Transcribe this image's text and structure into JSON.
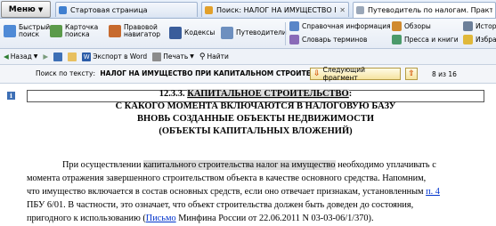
{
  "tabbar": {
    "menu_label": "Меню",
    "tabs": [
      {
        "label": "Стартовая страница",
        "active": false
      },
      {
        "label": "Поиск: НАЛОГ НА ИМУЩЕСТВО ПРИ...",
        "active": false
      },
      {
        "label": "Путеводитель по налогам. Практичес...",
        "active": true
      }
    ]
  },
  "bigbar": {
    "quick_search": [
      "Быстрый",
      "поиск"
    ],
    "search_card": [
      "Карточка",
      "поиска"
    ],
    "legal_nav": [
      "Правовой",
      "навигатор"
    ],
    "codes": "Кодексы",
    "guides": "Путеводители",
    "reference_info": "Справочная информация",
    "terms_dictionary": "Словарь терминов",
    "reviews": "Обзоры",
    "press_books": "Пресса и книги",
    "history": "Истор",
    "favorites": "Избран"
  },
  "navbar": {
    "back": "Назад",
    "export_word": "Экспорт в Word",
    "print": "Печать",
    "find": "Найти"
  },
  "searchbar": {
    "prefix": "Поиск по тексту:",
    "query": "НАЛОГ НА ИМУЩЕСТВО ПРИ КАПИТАЛЬНОМ СТРОИТЕЛЬСТВЕ",
    "next_fragment": "Следующий фрагмент",
    "counter": "8 из 16"
  },
  "document": {
    "info_marker": "i",
    "heading_num": "12.3.3. ",
    "heading_hl": "КАПИТАЛЬНОЕ СТРОИТЕЛЬСТВО",
    "heading_colon": ":",
    "heading_line2": "С КАКОГО МОМЕНТА ВКЛЮЧАЮТСЯ В НАЛОГОВУЮ БАЗУ",
    "heading_line3": "ВНОВЬ СОЗДАННЫЕ ОБЪЕКТЫ НЕДВИЖИМОСТИ",
    "heading_line4": "(ОБЪЕКТЫ КАПИТАЛЬНЫХ ВЛОЖЕНИЙ)",
    "p1_start": "При осуществлении ",
    "p1_hl": "капитального строительства налог на имущество",
    "p1_end": "  необходимо уплачивать с",
    "p2": "момента отражения завершенного строительством объекта в качестве основного средства. Напомним,",
    "p3_start": "что имущество включается в состав основных средств, если оно отвечает признакам, установленным ",
    "p3_link": "п. 4",
    "p4": "ПБУ 6/01. В частности, это означает, что объект строительства должен быть доведен до состояния,",
    "p5_start": "пригодного к использованию (",
    "p5_link": "Письмо",
    "p5_end": " Минфина России от 22.06.2011 N 03-03-06/1/370)."
  }
}
